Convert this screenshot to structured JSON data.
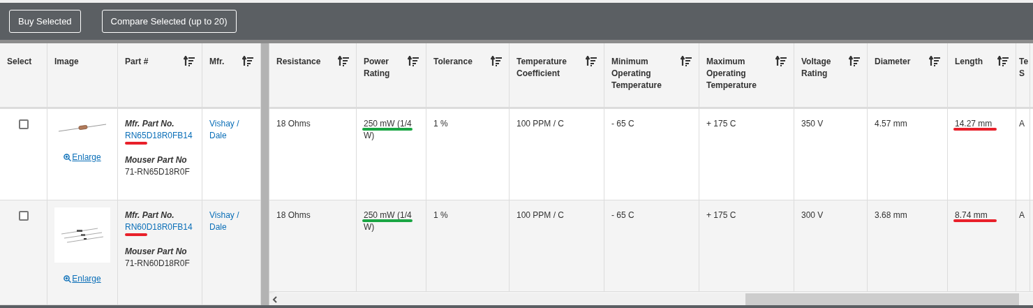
{
  "toolbar": {
    "buttons": [
      "Buy Selected",
      "Compare Selected (up to 20)"
    ]
  },
  "table": {
    "frozen_columns": [
      {
        "label": "Select",
        "sortable": false
      },
      {
        "label": "Image",
        "sortable": false
      },
      {
        "label": "Part #",
        "sortable": true
      },
      {
        "label": "Mfr.",
        "sortable": true
      }
    ],
    "columns": [
      {
        "label": "Resistance",
        "sortable": true
      },
      {
        "label": "Power Rating",
        "sortable": true
      },
      {
        "label": "Tolerance",
        "sortable": true
      },
      {
        "label": "Temperature Coefficient",
        "sortable": true
      },
      {
        "label": "Minimum Operating Temperature",
        "sortable": true
      },
      {
        "label": "Maximum Operating Temperature",
        "sortable": true
      },
      {
        "label": "Voltage Rating",
        "sortable": true
      },
      {
        "label": "Diameter",
        "sortable": true
      },
      {
        "label": "Length",
        "sortable": true
      },
      {
        "label": "Te S",
        "sortable": false
      }
    ],
    "rows": [
      {
        "checked": false,
        "image": {
          "kind": "single",
          "enlarge": "Enlarge"
        },
        "part": {
          "mfr_label": "Mfr. Part No.",
          "mfr_part_no": "RN65D18R0FB14",
          "color": "#e8202a",
          "mouser_label": "Mouser Part No",
          "mouser_part_no": "71-RN65D18R0F"
        },
        "mfr": "Vishay / Dale",
        "cells": [
          {
            "text": "18 Ohms"
          },
          {
            "text": "250 mW (1/4 W)",
            "color": "#1aa543"
          },
          {
            "text": "1 %"
          },
          {
            "text": "100 PPM / C"
          },
          {
            "text": "- 65 C"
          },
          {
            "text": "+ 175 C"
          },
          {
            "text": "350 V"
          },
          {
            "text": "4.57 mm"
          },
          {
            "text": "14.27 mm",
            "color": "#e8202a"
          },
          {
            "text": "A"
          }
        ]
      },
      {
        "checked": false,
        "image": {
          "kind": "trio",
          "enlarge": "Enlarge"
        },
        "part": {
          "mfr_label": "Mfr. Part No.",
          "mfr_part_no": "RN60D18R0FB14",
          "color": "#e8202a",
          "mouser_label": "Mouser Part No",
          "mouser_part_no": "71-RN60D18R0F"
        },
        "mfr": "Vishay / Dale",
        "cells": [
          {
            "text": "18 Ohms"
          },
          {
            "text": "250 mW (1/4 W)",
            "color": "#1aa543"
          },
          {
            "text": "1 %"
          },
          {
            "text": "100 PPM / C"
          },
          {
            "text": "- 65 C"
          },
          {
            "text": "+ 175 C"
          },
          {
            "text": "300 V"
          },
          {
            "text": "3.68 mm"
          },
          {
            "text": "8.74 mm",
            "color": "#e8202a"
          },
          {
            "text": "A"
          }
        ]
      }
    ]
  }
}
